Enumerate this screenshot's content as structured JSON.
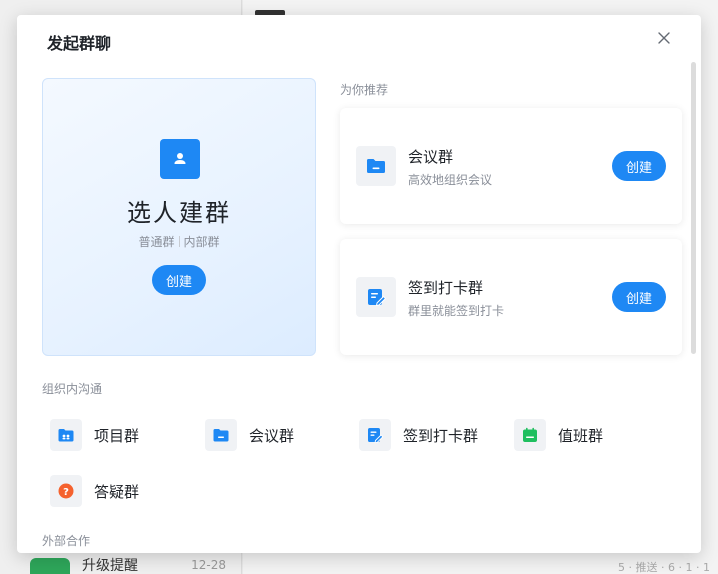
{
  "background": {
    "chat_item_title": "升级提醒",
    "chat_item_time": "12-28",
    "right_hint": "5 · 推送 · 6 · 1 · 1"
  },
  "modal": {
    "title": "发起群聊",
    "main_card": {
      "title": "选人建群",
      "tag_1": "普通群",
      "tag_2": "内部群",
      "button": "创建",
      "icon": "person-icon"
    },
    "recommend_label": "为你推荐",
    "recommend": [
      {
        "name": "会议群",
        "desc": "高效地组织会议",
        "button": "创建",
        "icon": "folder-icon"
      },
      {
        "name": "签到打卡群",
        "desc": "群里就能签到打卡",
        "button": "创建",
        "icon": "edit-icon"
      }
    ],
    "internal_label": "组织内沟通",
    "internal": [
      {
        "label": "项目群",
        "icon": "project-folder-icon"
      },
      {
        "label": "会议群",
        "icon": "folder-icon"
      },
      {
        "label": "签到打卡群",
        "icon": "edit-icon"
      },
      {
        "label": "值班群",
        "icon": "calendar-icon"
      },
      {
        "label": "答疑群",
        "icon": "question-icon"
      }
    ],
    "external_label": "外部合作"
  },
  "colors": {
    "accent": "#1e88f4",
    "duty_green": "#1fbf5f",
    "question_orange": "#f5622e"
  }
}
